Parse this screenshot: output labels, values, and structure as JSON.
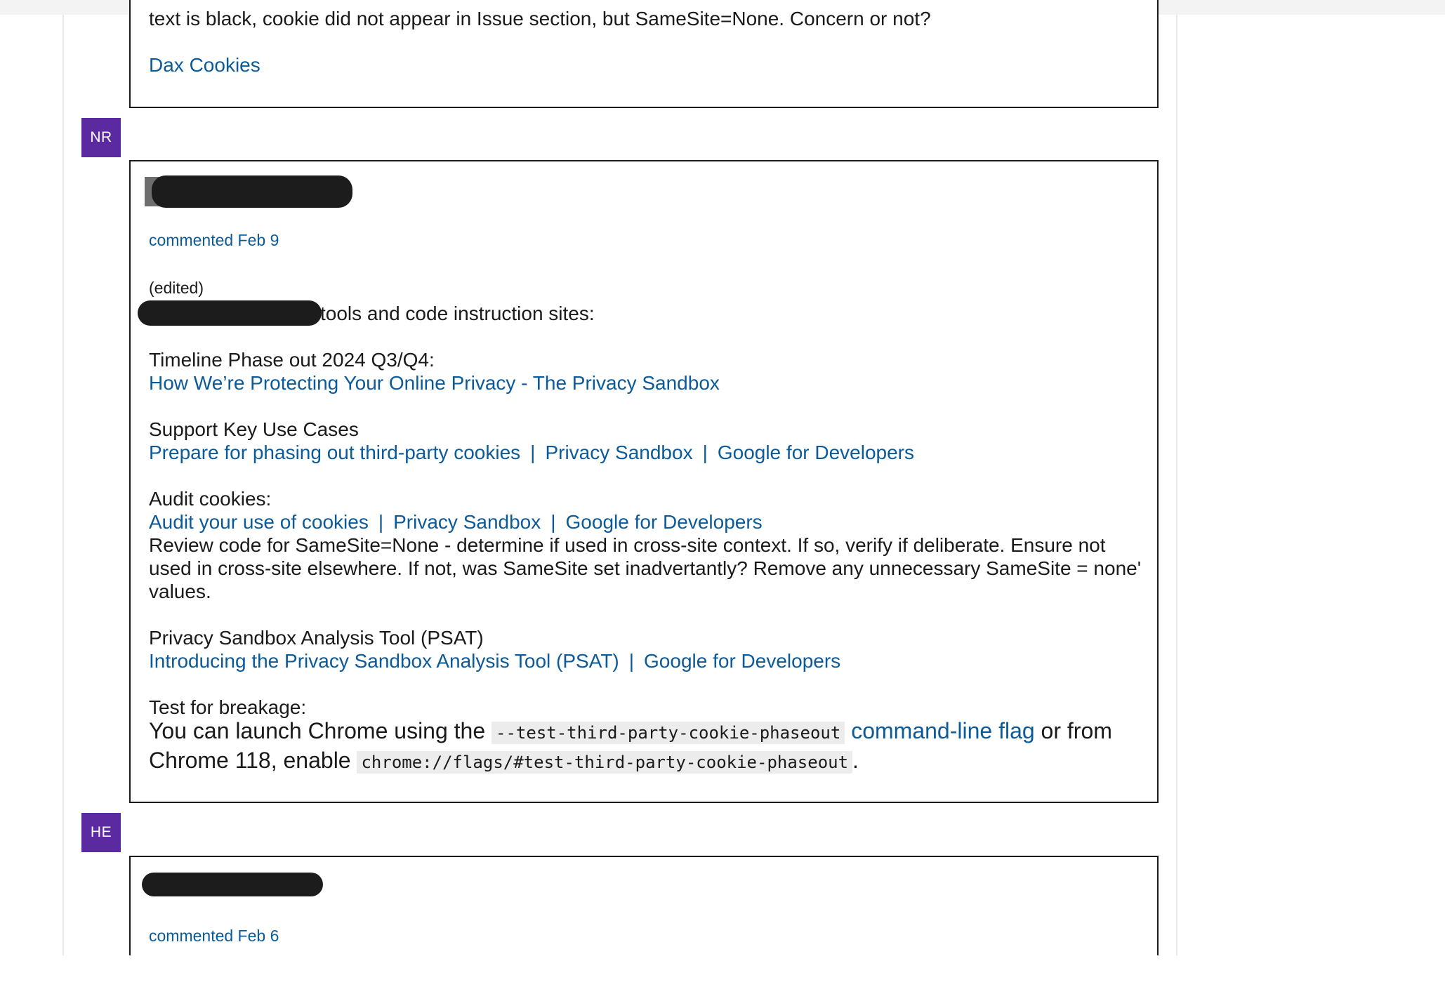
{
  "card_prev": {
    "body_tail": "text is black, cookie did not appear in Issue section, but SameSite=None.  Concern or not?",
    "link": "Dax Cookies"
  },
  "comment_nr": {
    "avatar": "NR",
    "meta": "commented Feb 9",
    "edited": "(edited)",
    "intro_tail": "tools and code instruction sites:",
    "timeline_label": "Timeline Phase out 2024 Q3/Q4:",
    "timeline_link": "How We’re Protecting Your Online Privacy - The Privacy Sandbox",
    "usecases_label": "Support Key Use Cases",
    "usecases_link1": "Prepare for phasing out third-party cookies",
    "usecases_link2": "Privacy Sandbox",
    "usecases_link3": "Google for Developers",
    "audit_label": "Audit cookies:",
    "audit_link1": "Audit your use of cookies",
    "audit_link2": "Privacy Sandbox",
    "audit_link3": "Google for Developers",
    "audit_text": "Review code for SameSite=None - determine if used in cross-site context.  If so, verify if deliberate.  Ensure not used in cross-site elsewhere.  If not, was SameSite set inadvertantly?  Remove any unnecessary SameSite = none' values.",
    "psat_label": "Privacy Sandbox Analysis Tool (PSAT)",
    "psat_link1": "Introducing the Privacy Sandbox Analysis Tool (PSAT)",
    "psat_link2": "Google for Developers",
    "separator": "|",
    "breakage_label": "Test for breakage:",
    "breakage_pre": "You can launch Chrome using the ",
    "breakage_code1": "--test-third-party-cookie-phaseout",
    "breakage_link": "command-line flag",
    "breakage_mid": " or from Chrome 118, enable ",
    "breakage_code2": "chrome://flags/#test-third-party-cookie-phaseout",
    "breakage_end": "."
  },
  "comment_he": {
    "avatar": "HE",
    "meta": "commented Feb 6"
  }
}
